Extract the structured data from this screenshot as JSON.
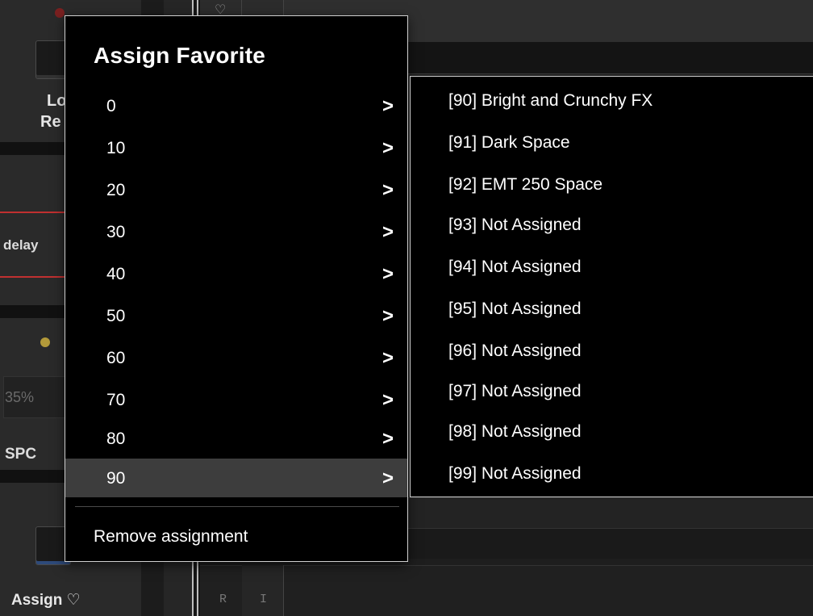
{
  "background": {
    "left_panel": {
      "label_lo_top": "Lo",
      "label_re": "Re",
      "delay_label": "delay",
      "percent_value": "35%",
      "spc_label": "SPC",
      "assign_label": "Assign",
      "heart_glyph": "♡",
      "colors": {
        "led_red": "#7a2020",
        "led_amber": "#b39a3a",
        "accent_line": "#c03030"
      }
    },
    "top_strip": {
      "heart_glyph": "♡"
    },
    "bottom_strip": {
      "r_label": "R",
      "i_label": "I"
    }
  },
  "menu": {
    "title": "Assign Favorite",
    "chevron": ">",
    "items": [
      {
        "label": "0",
        "selected": false
      },
      {
        "label": "10",
        "selected": false
      },
      {
        "label": "20",
        "selected": false
      },
      {
        "label": "30",
        "selected": false
      },
      {
        "label": "40",
        "selected": false
      },
      {
        "label": "50",
        "selected": false
      },
      {
        "label": "60",
        "selected": false
      },
      {
        "label": "70",
        "selected": false
      },
      {
        "label": "80",
        "selected": false
      },
      {
        "label": "90",
        "selected": true
      }
    ],
    "remove_label": "Remove assignment"
  },
  "submenu": {
    "items": [
      {
        "label": "[90] Bright and Crunchy FX"
      },
      {
        "label": "[91] Dark Space"
      },
      {
        "label": "[92] EMT 250 Space"
      },
      {
        "label": "[93] Not Assigned"
      },
      {
        "label": "[94] Not Assigned"
      },
      {
        "label": "[95] Not Assigned"
      },
      {
        "label": "[96] Not Assigned"
      },
      {
        "label": "[97] Not Assigned"
      },
      {
        "label": "[98] Not Assigned"
      },
      {
        "label": "[99] Not Assigned"
      }
    ]
  },
  "colors": {
    "menu_bg": "#000000",
    "menu_border": "#cfcfcf",
    "selected_bg": "#3d3d3d",
    "text": "#ffffff"
  }
}
